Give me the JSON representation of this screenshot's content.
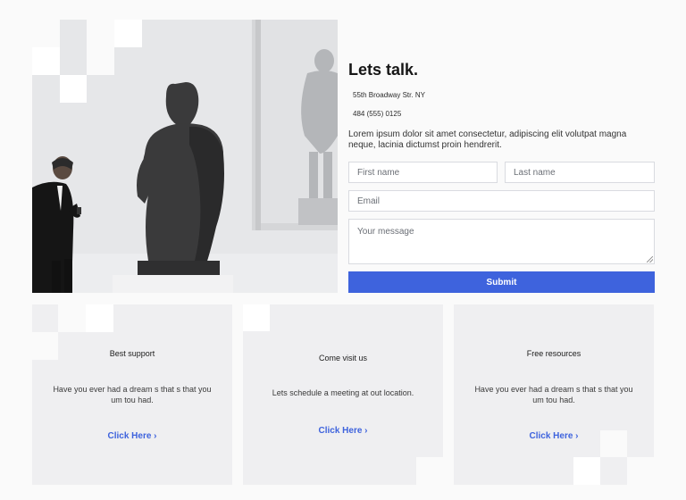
{
  "contact": {
    "title": "Lets talk.",
    "address": "55th Broadway Str. NY",
    "phone": "484 (555) 0125",
    "intro": "Lorem ipsum dolor sit amet consectetur, adipiscing elit volutpat magna neque, lacinia dictumst proin hendrerit.",
    "first_name_placeholder": "First name",
    "last_name_placeholder": "Last name",
    "email_placeholder": "Email",
    "message_placeholder": "Your message",
    "submit_label": "Submit"
  },
  "cards": [
    {
      "title": "Best support",
      "text": "Have you ever had a dream s that s that you um tou had.",
      "link": "Click Here ›"
    },
    {
      "title": "Come visit us",
      "text": "Lets schedule a meeting at out location.",
      "link": "Click Here ›"
    },
    {
      "title": "Free resources",
      "text": "Have you ever had a dream s that s that you um tou had.",
      "link": "Click Here ›"
    }
  ],
  "colors": {
    "accent": "#3e63dd",
    "card_bg": "#efeff1",
    "page_bg": "#fafafa"
  }
}
